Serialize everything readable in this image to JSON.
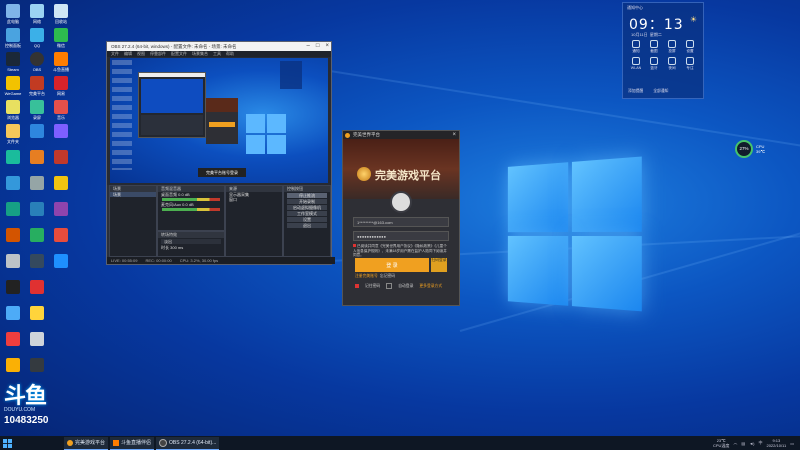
{
  "desktop": {
    "icons": [
      {
        "label": "此电脑"
      },
      {
        "label": "网络"
      },
      {
        "label": "回收站"
      },
      {
        "label": "控制面板"
      },
      {
        "label": "QQ"
      },
      {
        "label": "微信"
      },
      {
        "label": "Steam"
      },
      {
        "label": "OBS"
      },
      {
        "label": "斗鱼直播"
      },
      {
        "label": "WeGame"
      },
      {
        "label": "完美平台"
      },
      {
        "label": "网易"
      },
      {
        "label": "浏览器"
      },
      {
        "label": "录屏"
      },
      {
        "label": "音乐"
      },
      {
        "label": "文件夹"
      }
    ],
    "watermark_id": "10483250",
    "watermark_brand": "DOUYU.COM"
  },
  "obs": {
    "title": "OBS 27.2.4 (64-bit, windows) - 配置文件: 未命名 - 场景: 未命名",
    "menu": [
      "文件",
      "编辑",
      "视图",
      "停靠部件",
      "配置文件",
      "场景集合",
      "工具",
      "帮助"
    ],
    "preview_caption": "完美平台账号登录",
    "scenes_title": "场景",
    "scenes": [
      "场景"
    ],
    "sources_title": "来源",
    "sources": [
      "显示器采集",
      "窗口"
    ],
    "mixer_title": "音频混音器",
    "mixer": [
      {
        "label": "桌面音频",
        "db": "0.0 dB"
      },
      {
        "label": "麦克风/Aux",
        "db": "0.0 dB"
      }
    ],
    "transitions_title": "转场特效",
    "transition_value": "淡出",
    "duration_label": "时长",
    "duration_value": "300 ms",
    "controls_title": "控制按钮",
    "controls": [
      "停止推流",
      "开始录制",
      "启动虚拟摄像机",
      "工作室模式",
      "设置",
      "退出"
    ],
    "status": [
      "LIVE: 00:55:09",
      "REC: 00:00:00",
      "CPU: 3.2%, 30.00 fps"
    ]
  },
  "game_login": {
    "title": "完美世界平台",
    "brand": "完美游戏平台",
    "account": "1*********@163.com",
    "password": "●●●●●●●●●●●●",
    "notice": "已阅读并同意《完美世界用户协议》《隐私政策》《儿童个人信息保护规则》，未满18岁用户需在监护人陪同下阅读并同意。",
    "login_button": "登 录",
    "security_button": "扫码登录",
    "register": "注册完美账号",
    "forgot": "忘记密码",
    "remember": "记住密码",
    "auto_login": "自动登录",
    "more": "更多登录方式"
  },
  "widget": {
    "header": "通知中心",
    "time": "09：13",
    "date": "10月11日",
    "weekday": "星期二",
    "tiles": [
      {
        "label": "通知"
      },
      {
        "label": "截图"
      },
      {
        "label": "投屏"
      },
      {
        "label": "设置"
      },
      {
        "label": "WLAN"
      },
      {
        "label": "蓝牙"
      },
      {
        "label": "夜间"
      },
      {
        "label": "专注"
      }
    ],
    "footer_left": "添加提醒",
    "footer_right": "全部通知"
  },
  "cpu_widget": {
    "value": "27%",
    "label": "CPU",
    "temp": "39℃"
  },
  "taskbar": {
    "items": [
      "完美游戏平台",
      "斗鱼直播伴侣",
      "OBS 27.2.4 (64-bit)..."
    ],
    "tray_temp": "23℃",
    "tray_cpu": "CPU温度",
    "time": "9:13",
    "date": "2022/10/11",
    "lang": "中"
  },
  "colors": {
    "accent": "#1b86ef",
    "login": "#f0a020",
    "obs_bg": "#262a33"
  }
}
